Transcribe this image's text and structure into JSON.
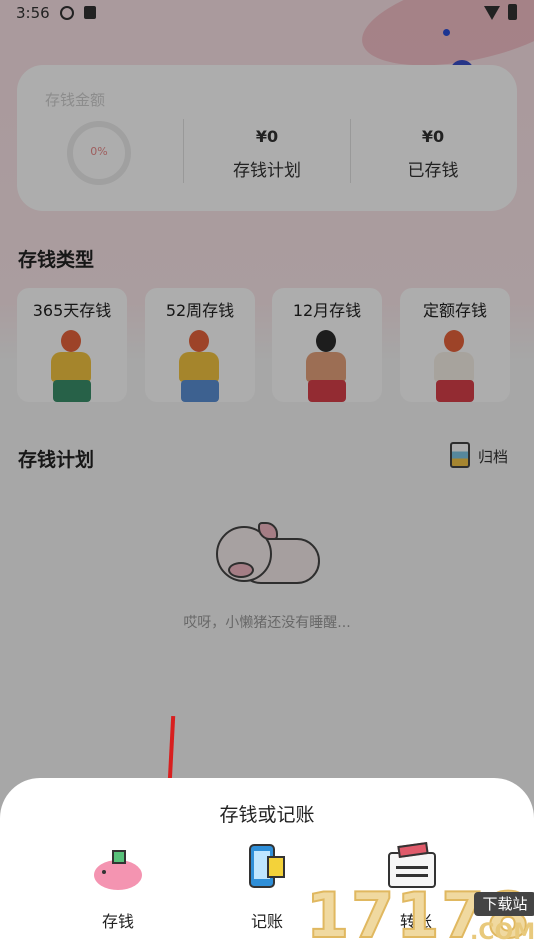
{
  "status_bar": {
    "time": "3:56"
  },
  "summary": {
    "label": "存钱金额",
    "progress_text": "0%",
    "plan_amount": "¥0",
    "plan_label": "存钱计划",
    "saved_amount": "¥0",
    "saved_label": "已存钱"
  },
  "types": {
    "title": "存钱类型",
    "items": [
      {
        "label": "365天存钱"
      },
      {
        "label": "52周存钱"
      },
      {
        "label": "12月存钱"
      },
      {
        "label": "定额存钱"
      }
    ]
  },
  "plans": {
    "title": "存钱计划",
    "archive_label": "归档",
    "empty_text": "哎呀，小懒猪还没有睡醒..."
  },
  "sheet": {
    "title": "存钱或记账",
    "actions": [
      {
        "label": "存钱",
        "icon": "piggy-bank-icon"
      },
      {
        "label": "记账",
        "icon": "phone-ledger-icon"
      },
      {
        "label": "转账",
        "icon": "wallet-transfer-icon"
      }
    ]
  },
  "watermark": {
    "digits": "17178",
    "badge": "下载站",
    "domain": ".COM"
  },
  "colors": {
    "pink_bg": "#fbe3e7",
    "arrow": "#d81f1f",
    "accent_pink": "#f494b1"
  }
}
